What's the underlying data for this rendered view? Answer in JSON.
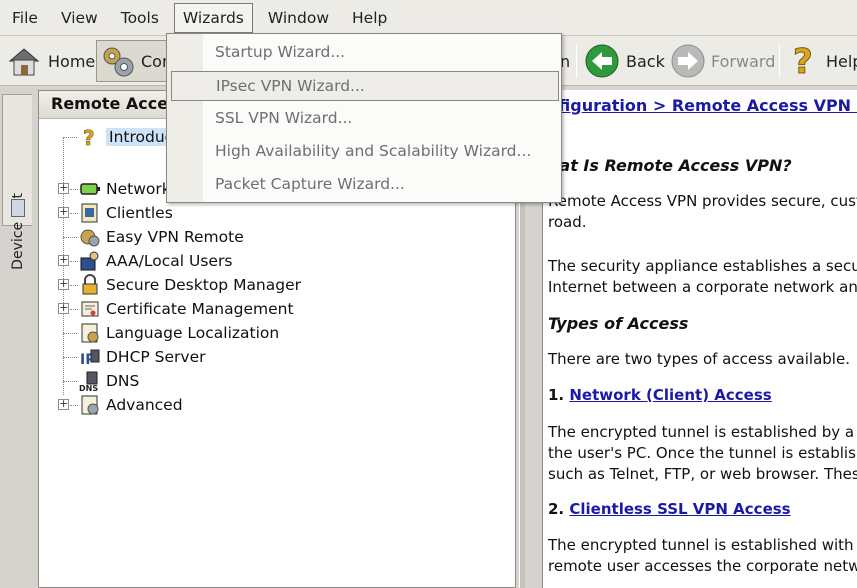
{
  "menubar": {
    "items": [
      "File",
      "View",
      "Tools",
      "Wizards",
      "Window",
      "Help"
    ],
    "active": "Wizards"
  },
  "toolbar": {
    "home_label": "Home",
    "config_label": "Con",
    "monitor_label": "n",
    "back_label": "Back",
    "forward_label": "Forward",
    "help_label": "Help"
  },
  "sidebar_tab": {
    "label": "Device List"
  },
  "left_panel": {
    "title": "Remote Acce",
    "tree": [
      {
        "label": "Introduc",
        "icon": "question-icon",
        "expandable": false
      },
      {
        "label": "Network",
        "icon": "network-client-icon",
        "expandable": true
      },
      {
        "label": "Clientles",
        "icon": "clientless-icon",
        "expandable": true
      },
      {
        "label": "Easy VPN Remote",
        "icon": "easy-vpn-icon",
        "expandable": false
      },
      {
        "label": "AAA/Local Users",
        "icon": "aaa-users-icon",
        "expandable": true
      },
      {
        "label": "Secure Desktop Manager",
        "icon": "lock-icon",
        "expandable": true
      },
      {
        "label": "Certificate Management",
        "icon": "certificate-icon",
        "expandable": true
      },
      {
        "label": "Language Localization",
        "icon": "language-icon",
        "expandable": false
      },
      {
        "label": "DHCP Server",
        "icon": "dhcp-icon",
        "expandable": false
      },
      {
        "label": "DNS",
        "icon": "dns-icon",
        "expandable": false
      },
      {
        "label": "Advanced",
        "icon": "advanced-icon",
        "expandable": true
      }
    ]
  },
  "wizards_menu": {
    "items": [
      "Startup Wizard...",
      "IPsec VPN Wizard...",
      "SSL VPN Wizard...",
      "High Availability and Scalability Wizard...",
      "Packet Capture Wizard..."
    ],
    "hovered": "IPsec VPN Wizard..."
  },
  "content": {
    "breadcrumb": "nfiguration > Remote Access VPN >",
    "heading1": "hat Is Remote Access VPN?",
    "p1_line1": "Remote Access VPN provides secure, custo",
    "p1_line2": "road.",
    "p2_line1": "The security appliance establishes a secure",
    "p2_line2": "Internet between a corporate network and",
    "heading2": "Types of Access",
    "p3": "There are two types of access available.",
    "item1_num": "1.",
    "item1_link": "Network (Client) Access",
    "p4_line1": "The encrypted tunnel is established by a sp",
    "p4_line2": "the user's PC. Once the tunnel is establishe",
    "p4_line3": "such as Telnet, FTP, or web browser. Thes",
    "item2_num": "2.",
    "item2_link": "Clientless SSL VPN Access",
    "p5_line1": "The encrypted tunnel is established with a c",
    "p5_line2": "remote user accesses the corporate netwo"
  }
}
